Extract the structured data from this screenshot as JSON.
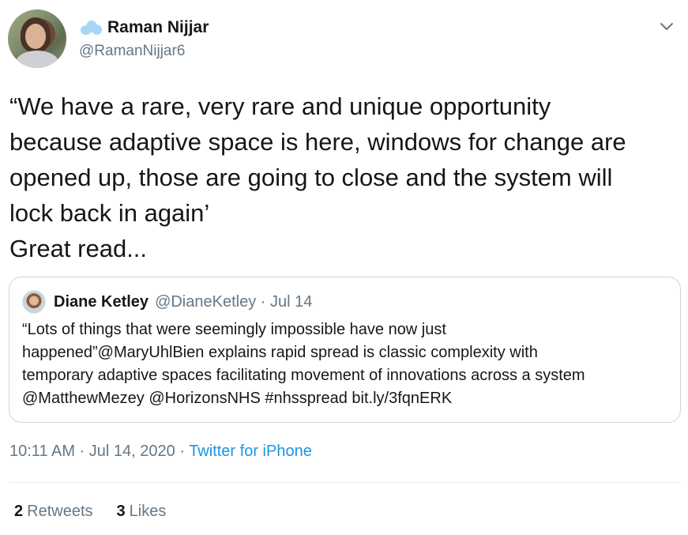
{
  "author": {
    "display_name": "Raman Nijjar",
    "handle": "@RamanNijjar6"
  },
  "tweet": {
    "text_lines": [
      "“We have a rare, very rare and unique opportunity",
      "because adaptive space is here, windows for change are",
      "opened up, those are going to close and the system will",
      "lock back in again’",
      "Great read..."
    ]
  },
  "quote": {
    "display_name": "Diane Ketley",
    "meta": "@DianeKetley · Jul 14",
    "text_lines": [
      "“Lots of things that were seemingly impossible have now just",
      "happened”@MaryUhlBien explains rapid spread is classic complexity with",
      "temporary adaptive spaces facilitating movement of innovations across a system",
      "@MatthewMezey @HorizonsNHS #nhsspread bit.ly/3fqnERK"
    ]
  },
  "timestamp": {
    "time_date": "10:11 AM · Jul 14, 2020 · ",
    "source": "Twitter for iPhone"
  },
  "stats": {
    "retweets_count": "2",
    "retweets_label": "Retweets",
    "likes_count": "3",
    "likes_label": "Likes"
  },
  "icons": {
    "profile_badge": "cloud-icon",
    "menu": "chevron-down-icon"
  },
  "colors": {
    "link": "#1b95e0",
    "secondary_text": "#657786",
    "border": "#ccd6dd"
  }
}
